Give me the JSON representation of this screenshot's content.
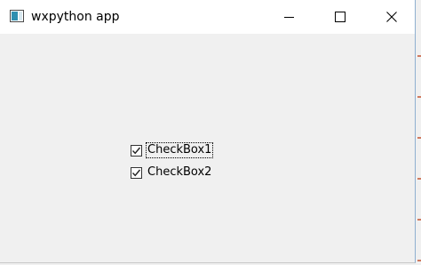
{
  "window": {
    "title": "wxpython app"
  },
  "titlebar": {
    "app_icon": "app-window-icon",
    "minimize_icon": "minimize-icon",
    "maximize_icon": "maximize-icon",
    "close_icon": "close-icon"
  },
  "checkboxes": [
    {
      "label": "CheckBox1",
      "checked": true,
      "focused": true
    },
    {
      "label": "CheckBox2",
      "checked": true,
      "focused": false
    }
  ],
  "colors": {
    "window_background": "#f0f0f0",
    "titlebar_background": "#ffffff",
    "text": "#000000"
  }
}
